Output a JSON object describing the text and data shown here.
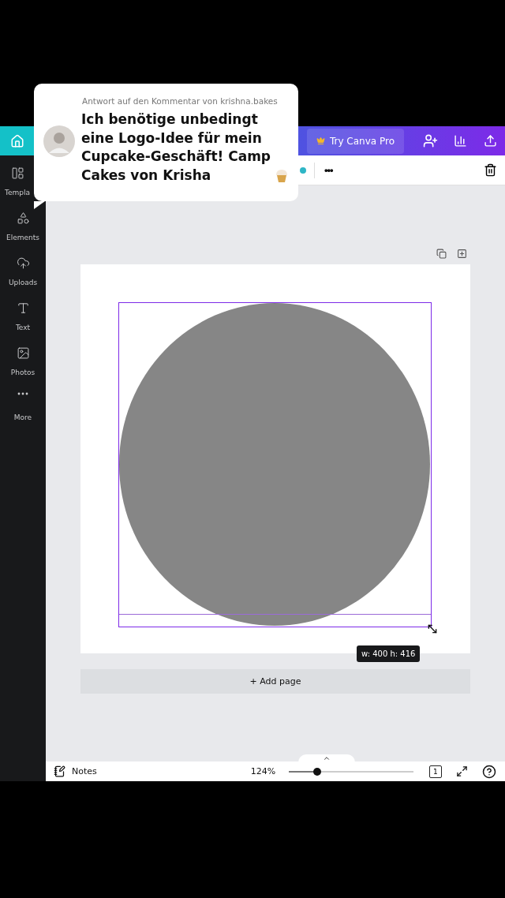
{
  "comment": {
    "reply_to": "Antwort auf den Kommentar von krishna.bakes",
    "text": "Ich benötige unbedingt eine Logo-Idee für mein Cupcake-Geschäft! Camp Cakes von Krisha"
  },
  "header": {
    "pro_button": "Try Canva Pro"
  },
  "sidebar": {
    "items": [
      {
        "kind": "templates",
        "label": "Templa"
      },
      {
        "kind": "elements",
        "label": "Elements"
      },
      {
        "kind": "uploads",
        "label": "Uploads"
      },
      {
        "kind": "text",
        "label": "Text"
      },
      {
        "kind": "photos",
        "label": "Photos"
      },
      {
        "kind": "more",
        "label": "More"
      }
    ]
  },
  "toolbar": {
    "more": "•••"
  },
  "canvas": {
    "size_tooltip": "w: 400 h: 416",
    "add_page": "+ Add page"
  },
  "footer": {
    "notes": "Notes",
    "zoom": "124%",
    "zoom_slider": {
      "level": 0.23
    },
    "page_count": "1"
  }
}
